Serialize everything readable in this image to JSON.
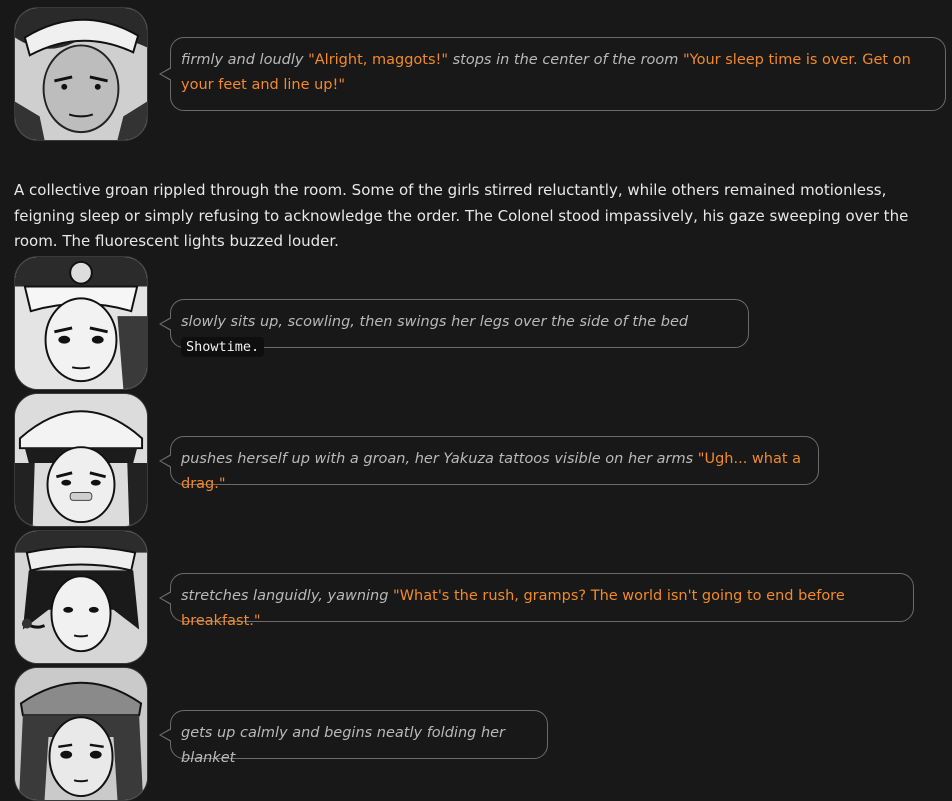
{
  "messages": [
    {
      "avatar": "character-portrait-colonel",
      "action_1": "firmly and loudly",
      "speech_1": "\"Alright, maggots!\"",
      "action_2": "stops in the center of the room",
      "speech_2": "\"Your sleep time is over. Get on your feet and line up!\""
    },
    {
      "avatar": "character-portrait-girl-goggles",
      "action_1": "slowly sits up, scowling, then swings her legs over the side of the bed",
      "code": "Showtime."
    },
    {
      "avatar": "character-portrait-girl-yakuza",
      "action_1": "pushes herself up with a groan, her Yakuza tattoos visible on her arms",
      "speech_1": "\"Ugh... what a drag.\""
    },
    {
      "avatar": "character-portrait-girl-headset",
      "action_1": "stretches languidly, yawning",
      "speech_1": "\"What's the rush, gramps? The world isn't going to end before breakfast.\""
    },
    {
      "avatar": "character-portrait-girl-cap",
      "action_1": "gets up calmly and begins neatly folding her blanket"
    }
  ],
  "narration": "A collective groan rippled through the room. Some of the girls stirred reluctantly, while others remained motionless, feigning sleep or simply refusing to acknowledge the order. The Colonel stood impassively, his gaze sweeping over the room. The fluorescent lights buzzed louder.",
  "colors": {
    "background": "#181818",
    "speech": "#f08a2c",
    "action": "#b9b9b9",
    "bubble_border": "#6b6b6b"
  }
}
